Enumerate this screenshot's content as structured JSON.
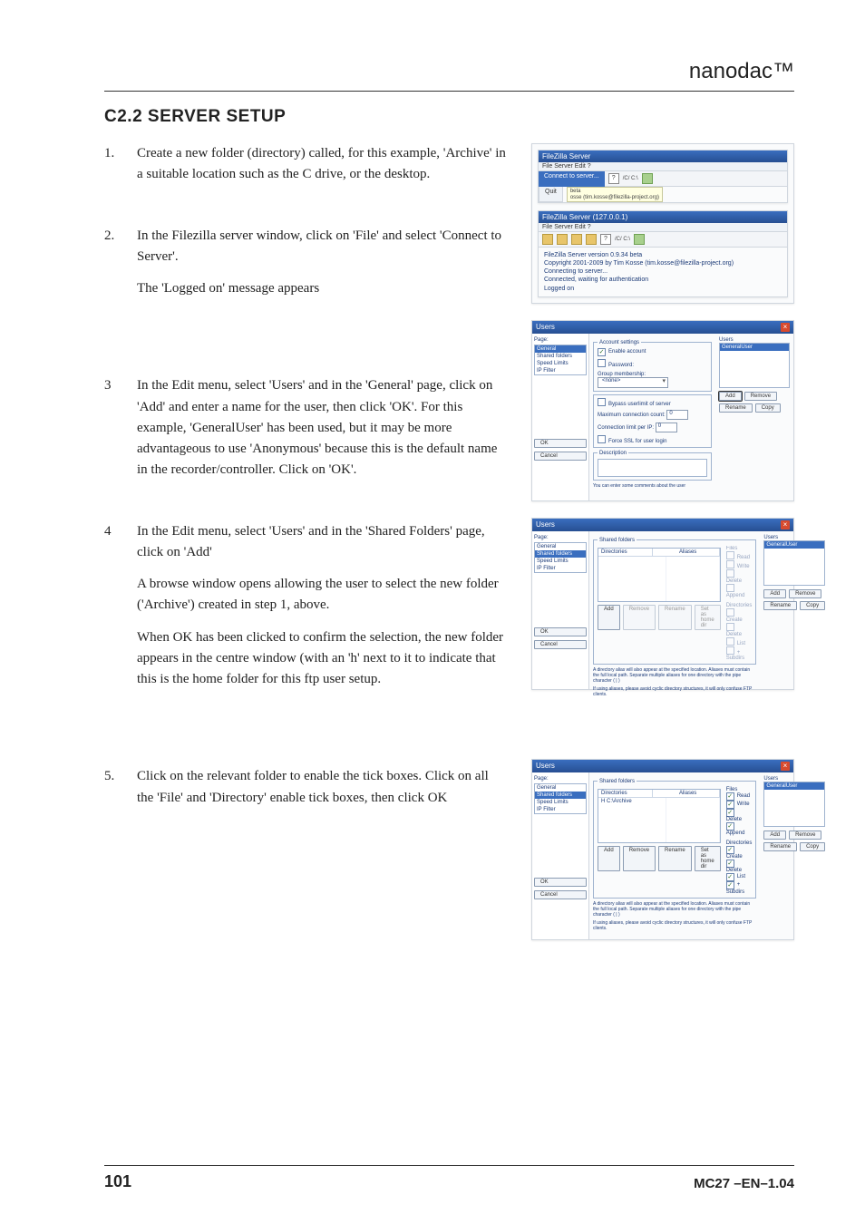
{
  "brand": "nanodac™",
  "heading": "C2.2 SERVER SETUP",
  "steps": [
    {
      "num": "1.",
      "paras": [
        "Create a new folder (directory) called, for this example, 'Archive' in a suitable location such as the C drive, or the desktop."
      ]
    },
    {
      "num": "2.",
      "paras": [
        "In the Filezilla server window, click on 'File' and select 'Connect to Server'.",
        "The 'Logged on' message appears"
      ]
    },
    {
      "num": "3",
      "paras": [
        "In the Edit menu, select 'Users' and in the  'General' page, click on 'Add' and enter a name for the user, then click 'OK'.  For this example, 'GeneralUser' has been used, but it may be more advantageous to use 'Anonymous' because this is the default name in the recorder/controller.  Click on 'OK'."
      ]
    },
    {
      "num": "4",
      "paras": [
        "In the Edit menu, select 'Users' and in the  'Shared Folders' page, click on 'Add'",
        "A browse window opens allowing the user to select the new folder ('Archive') created in step 1, above.",
        "When OK has been clicked to confirm the selection, the new folder appears in the centre window (with an 'h' next to it to indicate that this is the home folder for this ftp user setup."
      ]
    },
    {
      "num": "5.",
      "paras": [
        "Click on the relevant folder to enable the tick boxes. Click on all the 'File' and 'Directory' enable tick boxes, then click OK"
      ]
    }
  ],
  "fig1": {
    "title1": "FileZilla Server",
    "menubar1": "File   Server   Edit   ?",
    "menu_connect": "Connect to server...",
    "menu_quit": "Quit",
    "tip_beta": "beta",
    "tip_kosse": "osse (tim.kosse@filezilla-project.org)",
    "title2": "FileZilla Server (127.0.0.1)",
    "menubar2": "File   Server   Edit   ?",
    "toolbar_text": "/C/  C:\\",
    "log": [
      "FileZilla Server version 0.9.34 beta",
      "Copyright 2001-2009 by Tim Kosse (tim.kosse@filezilla-project.org)",
      "Connecting to server...",
      "Connected, waiting for authentication",
      "Logged on"
    ]
  },
  "usersCommon": {
    "title": "Users",
    "side_label": "Page:",
    "side_items": [
      "General",
      "Shared folders",
      "Speed Limits",
      "IP Filter"
    ],
    "right_label": "Users",
    "right_user": "GeneralUser",
    "btn_add": "Add",
    "btn_remove": "Remove",
    "btn_rename": "Rename",
    "btn_copy": "Copy",
    "btn_ok": "OK",
    "btn_cancel": "Cancel"
  },
  "fig2": {
    "grp_account": "Account settings",
    "enable_account": "Enable account",
    "password": "Password:",
    "group_memb": "Group membership:",
    "group_none": "<none>",
    "bypass": "Bypass userlimit of server",
    "max_conn": "Maximum connection count:",
    "conn_ip": "Connection limit per IP:",
    "force_ssl": "Force SSL for user login",
    "val0": "0",
    "desc": "Description",
    "desc_note": "You can enter some comments about the user"
  },
  "shared": {
    "legend": "Shared folders",
    "col_dirs": "Directories",
    "col_aliases": "Aliases",
    "files_label": "Files",
    "files": [
      "Read",
      "Write",
      "Delete",
      "Append"
    ],
    "dirs_label": "Directories",
    "dirs": [
      "Create",
      "Delete",
      "List",
      "+ Subdirs"
    ],
    "btn_set_home": "Set as home dir",
    "note1": "A directory alias will also appear at the specified location. Aliases must contain the full local path. Separate multiple aliases for one directory with the pipe character ( | )",
    "note2": "If using aliases, please avoid cyclic directory structures, it will only confuse FTP clients."
  },
  "fig4": {
    "row_h": "H  C:\\Archive"
  },
  "footer": {
    "page": "101",
    "docid": "MC27 –EN–1.04"
  }
}
